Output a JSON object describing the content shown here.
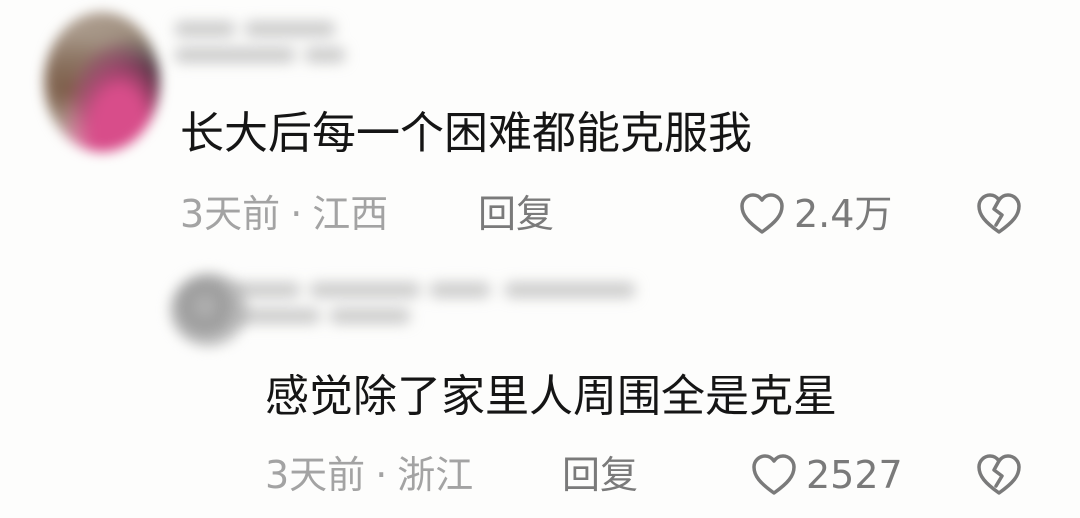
{
  "comments": [
    {
      "text": "长大后每一个困难都能克服我",
      "time": "3天前",
      "separator": "·",
      "location": "江西",
      "reply_label": "回复",
      "like_count": "2.4万"
    },
    {
      "text": "感觉除了家里人周围全是克星",
      "time": "3天前",
      "separator": "·",
      "location": "浙江",
      "reply_label": "回复",
      "like_count": "2527"
    }
  ],
  "icons": {
    "like": "heart-outline-icon",
    "dislike": "broken-heart-icon"
  },
  "colors": {
    "text": "#151515",
    "meta": "#a3a3a3",
    "action": "#7a7a7a",
    "background": "#fdfdfc"
  }
}
